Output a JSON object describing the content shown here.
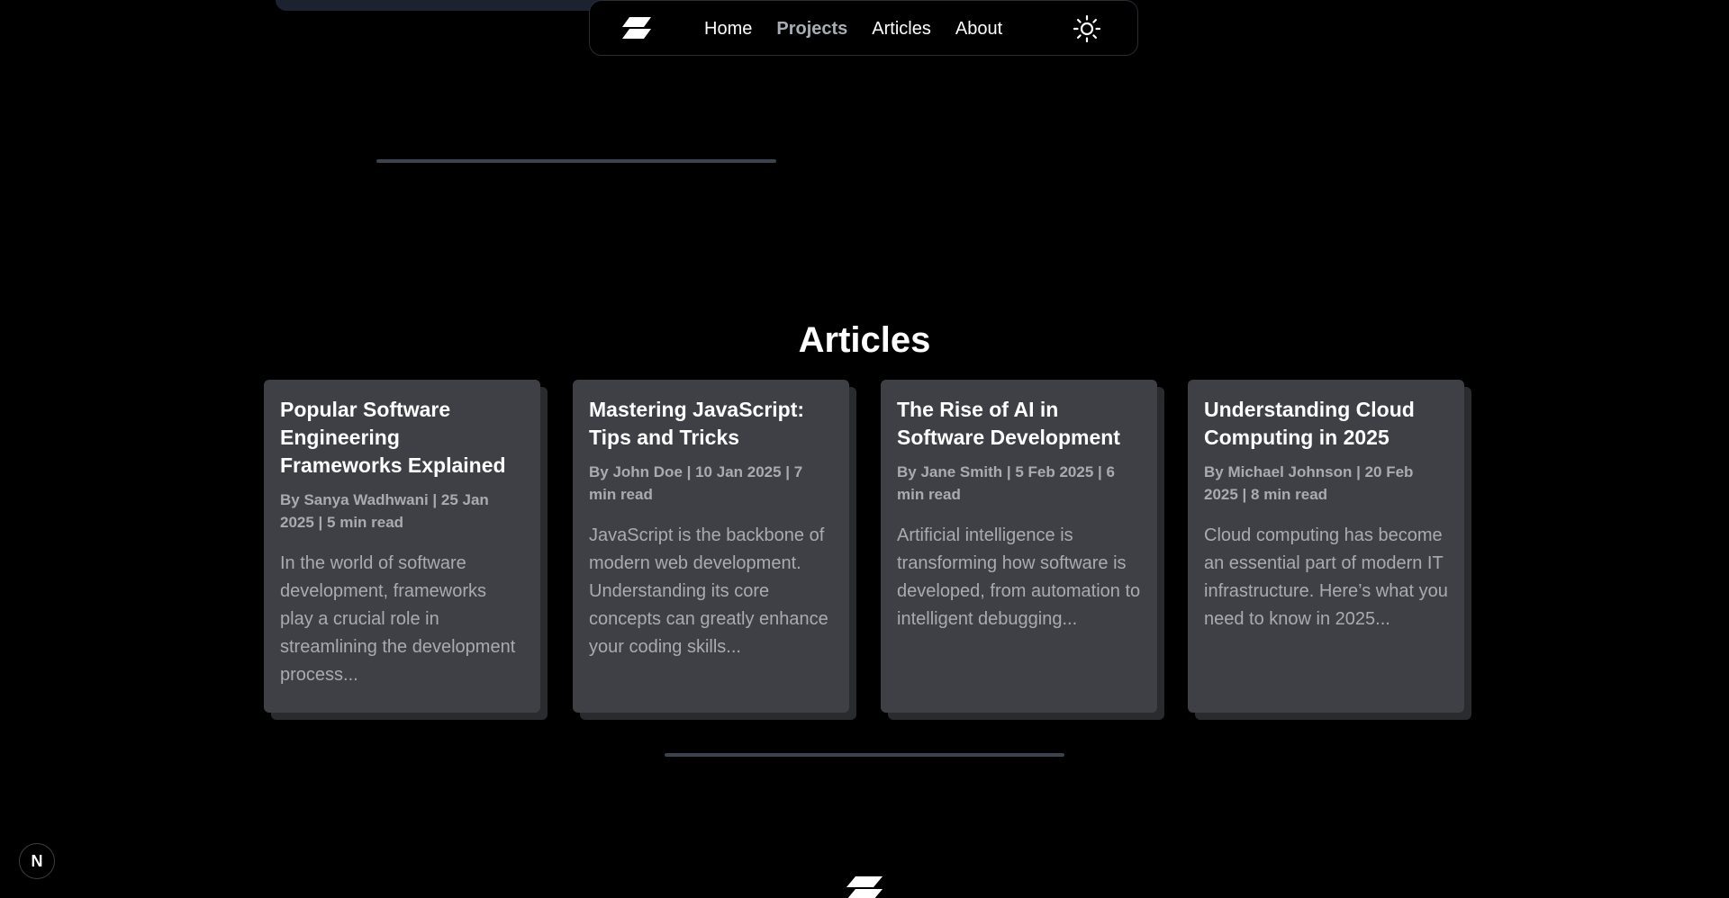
{
  "nav": {
    "items": [
      {
        "label": "Home",
        "active": false
      },
      {
        "label": "Projects",
        "active": true
      },
      {
        "label": "Articles",
        "active": false
      },
      {
        "label": "About",
        "active": false
      }
    ],
    "logo_icon": "brand-logo-icon",
    "theme_icon": "sun-icon"
  },
  "articles": {
    "title": "Articles",
    "items": [
      {
        "title": "Popular Software Engineering Frameworks Explained",
        "meta": "By Sanya Wadhwani | 25 Jan 2025 | 5 min read",
        "excerpt": "In the world of software development, frameworks play a crucial role in streamlining the development process..."
      },
      {
        "title": "Mastering JavaScript: Tips and Tricks",
        "meta": "By John Doe | 10 Jan 2025 | 7 min read",
        "excerpt": "JavaScript is the backbone of modern web development. Understanding its core concepts can greatly enhance your coding skills..."
      },
      {
        "title": "The Rise of AI in Software Development",
        "meta": "By Jane Smith | 5 Feb 2025 | 6 min read",
        "excerpt": "Artificial intelligence is transforming how software is developed, from automation to intelligent debugging..."
      },
      {
        "title": "Understanding Cloud Computing in 2025",
        "meta": "By Michael Johnson | 20 Feb 2025 | 8 min read",
        "excerpt": "Cloud computing has become an essential part of modern IT infrastructure. Here’s what you need to know in 2025..."
      }
    ]
  },
  "dev_badge": {
    "label": "N"
  },
  "colors": {
    "background": "#000000",
    "card": "#3f4045",
    "muted_text": "#a9abb1",
    "divider": "#3a4350"
  }
}
